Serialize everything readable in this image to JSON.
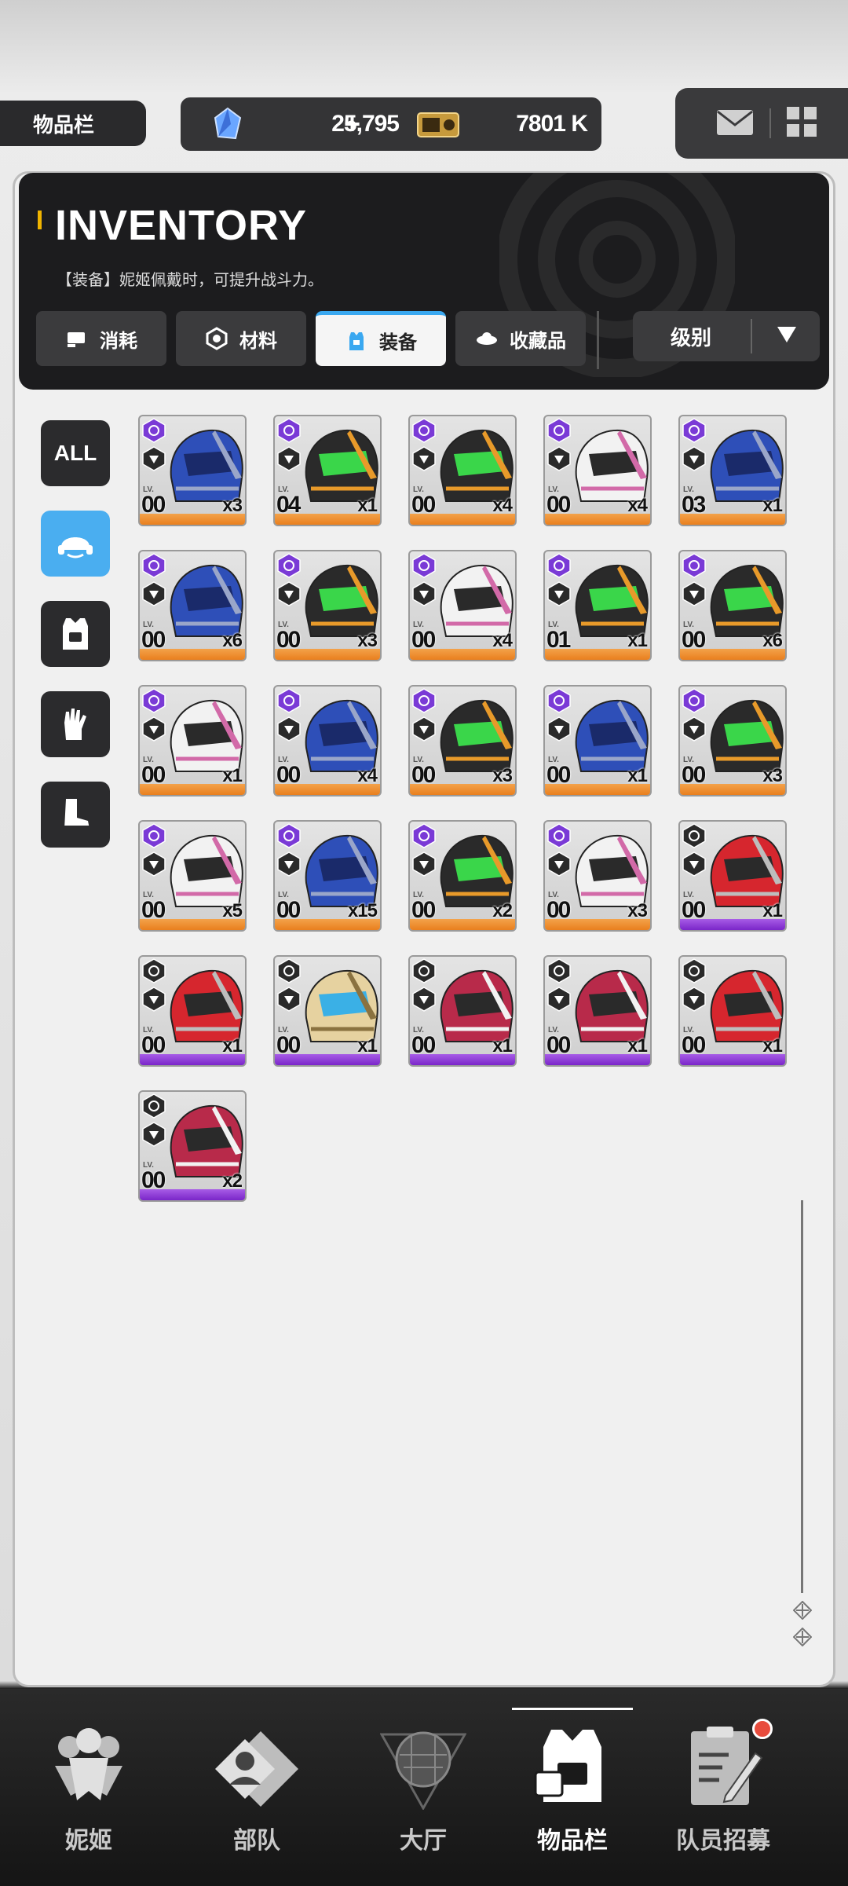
{
  "top_bar": {
    "page_tag": "物品栏",
    "gems": "25,795",
    "gems_plus": "+",
    "gold": "7801 K"
  },
  "header": {
    "title": "INVENTORY",
    "subtitle": "【装备】妮姬佩戴时，可提升战斗力。",
    "tabs": [
      {
        "label": "消耗",
        "icon": "consumable-icon",
        "active": false
      },
      {
        "label": "材料",
        "icon": "material-icon",
        "active": false
      },
      {
        "label": "装备",
        "icon": "equipment-icon",
        "active": true
      },
      {
        "label": "收藏品",
        "icon": "collectible-icon",
        "active": false
      }
    ],
    "sort_label": "级别"
  },
  "side_filters": [
    {
      "label": "ALL",
      "icon": "",
      "active": false
    },
    {
      "label": "",
      "icon": "helmet-icon",
      "active": true
    },
    {
      "label": "",
      "icon": "armor-vest-icon",
      "active": false
    },
    {
      "label": "",
      "icon": "gloves-icon",
      "active": false
    },
    {
      "label": "",
      "icon": "boots-icon",
      "active": false
    }
  ],
  "items": [
    {
      "lv": "00",
      "qty": "x3",
      "rarity": "orange",
      "helmet": "blue"
    },
    {
      "lv": "04",
      "qty": "x1",
      "rarity": "orange",
      "helmet": "black-green"
    },
    {
      "lv": "00",
      "qty": "x4",
      "rarity": "orange",
      "helmet": "black-green"
    },
    {
      "lv": "00",
      "qty": "x4",
      "rarity": "orange",
      "helmet": "pink-white"
    },
    {
      "lv": "03",
      "qty": "x1",
      "rarity": "orange",
      "helmet": "blue"
    },
    {
      "lv": "00",
      "qty": "x6",
      "rarity": "orange",
      "helmet": "blue"
    },
    {
      "lv": "00",
      "qty": "x3",
      "rarity": "orange",
      "helmet": "black-green"
    },
    {
      "lv": "00",
      "qty": "x4",
      "rarity": "orange",
      "helmet": "pink-white"
    },
    {
      "lv": "01",
      "qty": "x1",
      "rarity": "orange",
      "helmet": "black-green"
    },
    {
      "lv": "00",
      "qty": "x6",
      "rarity": "orange",
      "helmet": "black-green"
    },
    {
      "lv": "00",
      "qty": "x1",
      "rarity": "orange",
      "helmet": "pink-white"
    },
    {
      "lv": "00",
      "qty": "x4",
      "rarity": "orange",
      "helmet": "blue"
    },
    {
      "lv": "00",
      "qty": "x3",
      "rarity": "orange",
      "helmet": "black-green"
    },
    {
      "lv": "00",
      "qty": "x1",
      "rarity": "orange",
      "helmet": "blue"
    },
    {
      "lv": "00",
      "qty": "x3",
      "rarity": "orange",
      "helmet": "black-green"
    },
    {
      "lv": "00",
      "qty": "x5",
      "rarity": "orange",
      "helmet": "pink-white"
    },
    {
      "lv": "00",
      "qty": "x15",
      "rarity": "orange",
      "helmet": "blue"
    },
    {
      "lv": "00",
      "qty": "x2",
      "rarity": "orange",
      "helmet": "black-green"
    },
    {
      "lv": "00",
      "qty": "x3",
      "rarity": "orange",
      "helmet": "pink-white"
    },
    {
      "lv": "00",
      "qty": "x1",
      "rarity": "purple",
      "helmet": "red"
    },
    {
      "lv": "00",
      "qty": "x1",
      "rarity": "purple",
      "helmet": "red"
    },
    {
      "lv": "00",
      "qty": "x1",
      "rarity": "purple",
      "helmet": "gold"
    },
    {
      "lv": "00",
      "qty": "x1",
      "rarity": "purple",
      "helmet": "crimson"
    },
    {
      "lv": "00",
      "qty": "x1",
      "rarity": "purple",
      "helmet": "crimson"
    },
    {
      "lv": "00",
      "qty": "x1",
      "rarity": "purple",
      "helmet": "red"
    },
    {
      "lv": "00",
      "qty": "x2",
      "rarity": "purple",
      "helmet": "crimson"
    }
  ],
  "item_lv_label": "LV.",
  "bottom_nav": [
    {
      "label": "妮姬",
      "icon": "nikke-icon",
      "active": false
    },
    {
      "label": "部队",
      "icon": "squad-icon",
      "active": false
    },
    {
      "label": "大厅",
      "icon": "lobby-icon",
      "active": false
    },
    {
      "label": "物品栏",
      "icon": "inventory-icon",
      "active": true
    },
    {
      "label": "队员招募",
      "icon": "recruit-icon",
      "active": false
    }
  ]
}
